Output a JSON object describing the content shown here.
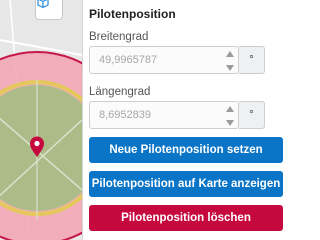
{
  "map": {
    "toolbar_icon": "cube-icon",
    "marker_icon": "location-pin-icon",
    "colors": {
      "outer_zone": "#f2a2b0",
      "outer_ring": "#c5174a",
      "inner_ring": "#e5c85c",
      "inner_zone": "#a8bd86"
    }
  },
  "panel": {
    "title": "Pilotenposition",
    "latitude": {
      "label": "Breitengrad",
      "value": "49,9965787",
      "unit": "°"
    },
    "longitude": {
      "label": "Längengrad",
      "value": "8,6952839",
      "unit": "°"
    },
    "buttons": {
      "set_position": "Neue Pilotenposition setzen",
      "show_on_map": "Pilotenposition auf Karte anzeigen",
      "delete": "Pilotenposition löschen"
    }
  },
  "colors": {
    "primary": "#0a74c7",
    "danger": "#c5093f"
  }
}
